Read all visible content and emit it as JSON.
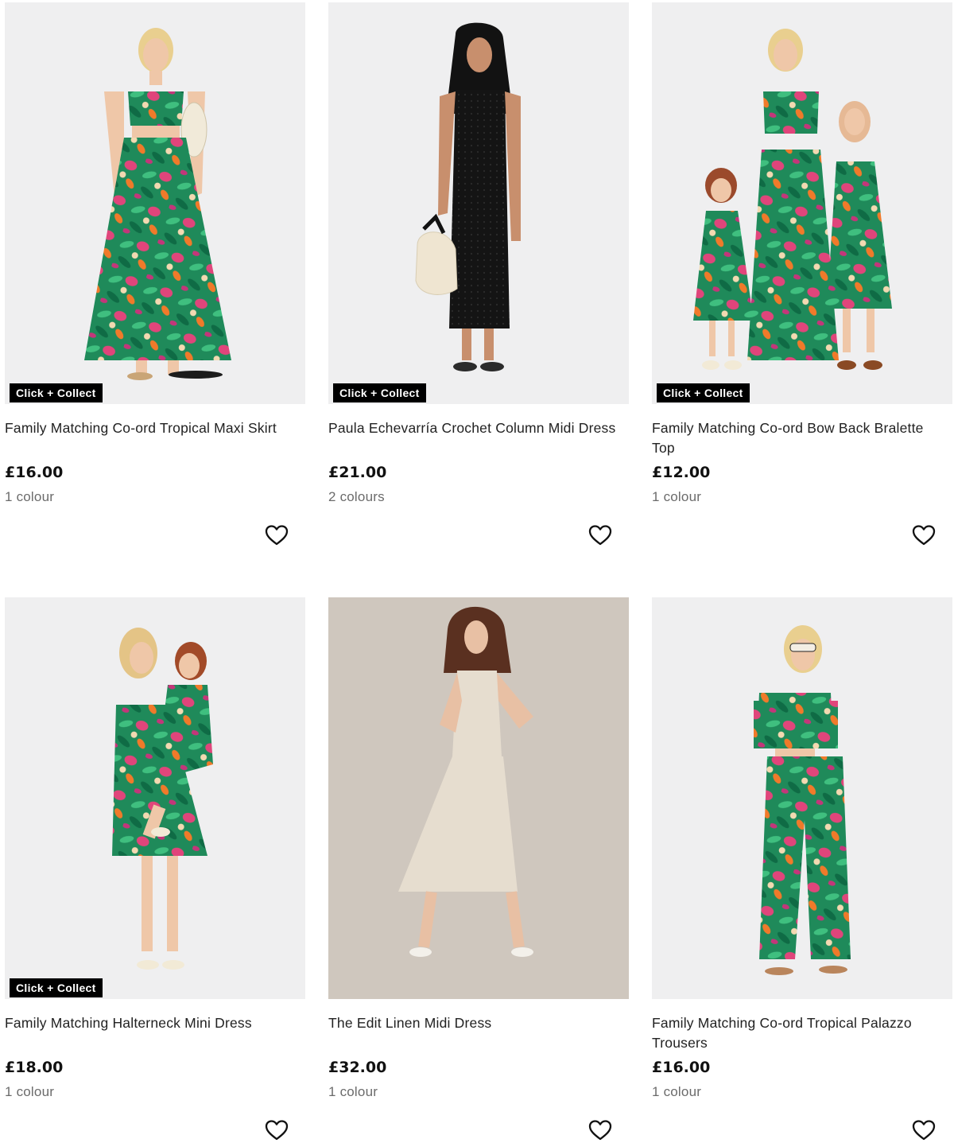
{
  "products": [
    {
      "badge": "Click + Collect",
      "title": "Family Matching Co-ord Tropical Maxi Skirt",
      "price": "£16.00",
      "colours": "1 colour",
      "photo_bg": "#efeff0",
      "icon": "heart-outline-icon"
    },
    {
      "badge": "Click + Collect",
      "title": "Paula Echevarría Crochet Column Midi Dress",
      "price": "£21.00",
      "colours": "2 colours",
      "photo_bg": "#efeff0",
      "icon": "heart-outline-icon"
    },
    {
      "badge": "Click + Collect",
      "title": "Family Matching Co-ord Bow Back Bralette Top",
      "price": "£12.00",
      "colours": "1 colour",
      "photo_bg": "#efeff0",
      "icon": "heart-outline-icon"
    },
    {
      "badge": "Click + Collect",
      "title": "Family Matching Halterneck Mini Dress",
      "price": "£18.00",
      "colours": "1 colour",
      "photo_bg": "#efeff0",
      "icon": "heart-outline-icon"
    },
    {
      "badge": "",
      "title": "The Edit Linen Midi Dress",
      "price": "£32.00",
      "colours": "1 colour",
      "photo_bg": "#cfc7be",
      "icon": "heart-outline-icon"
    },
    {
      "badge": "",
      "title": "Family Matching Co-ord Tropical Palazzo Trousers",
      "price": "£16.00",
      "colours": "1 colour",
      "photo_bg": "#efeff0",
      "icon": "heart-outline-icon"
    }
  ],
  "colors": {
    "badge_bg": "#000000",
    "badge_text": "#ffffff",
    "price_text": "#111111",
    "meta_text": "#6b6b6b",
    "tropical_green": "#1f8a5a",
    "tropical_pink": "#e0457b",
    "tropical_orange": "#f07a2a",
    "crochet_black": "#141414",
    "linen": "#e6ddcf"
  }
}
